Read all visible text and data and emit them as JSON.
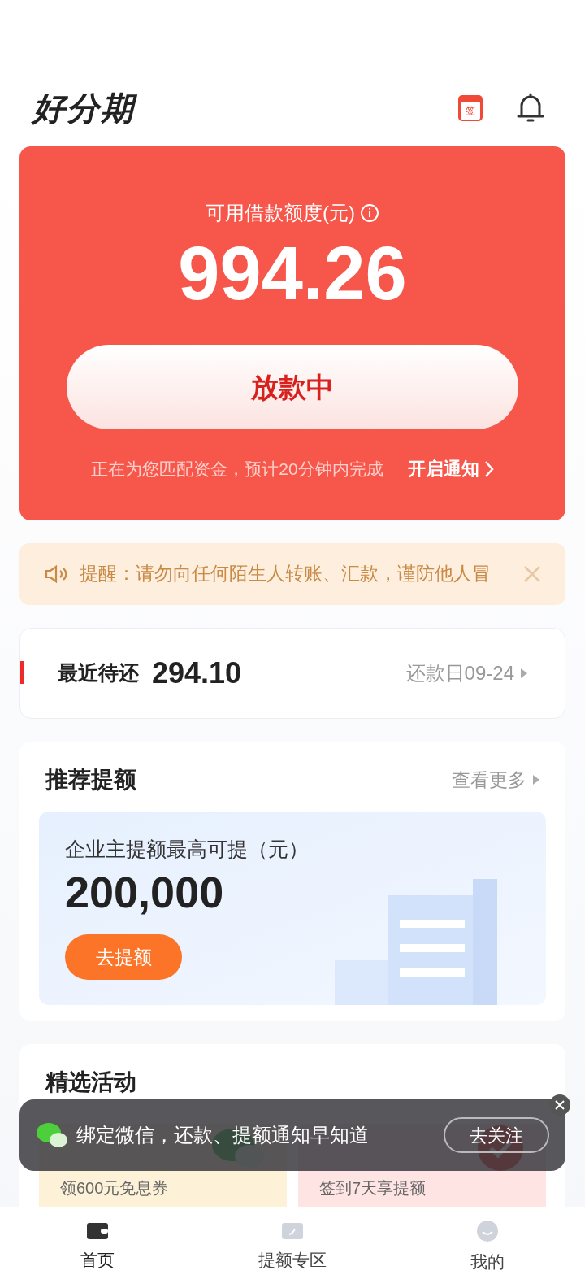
{
  "header": {
    "logo": "好分期",
    "checkin_badge": "签"
  },
  "credit_card": {
    "label": "可用借款额度(元)",
    "amount": "994.26",
    "button": "放款中",
    "status": "正在为您匹配资金，预计20分钟内完成",
    "notify_link": "开启通知"
  },
  "reminder": {
    "text": "提醒：请勿向任何陌生人转账、汇款，谨防他人冒"
  },
  "repayment": {
    "label": "最近待还",
    "amount": "294.10",
    "due": "还款日09-24"
  },
  "recommend": {
    "title": "推荐提额",
    "more": "查看更多",
    "offer_label": "企业主提额最高可提（元）",
    "offer_amount": "200,000",
    "button": "去提额"
  },
  "activities": {
    "title": "精选活动",
    "items": [
      {
        "subtitle": "领600元免息券",
        "kind": "wechat"
      },
      {
        "subtitle": "签到7天享提额",
        "kind": "checkin"
      }
    ]
  },
  "toast": {
    "text": "绑定微信，还款、提额通知早知道",
    "button": "去关注"
  },
  "nav": [
    {
      "label": "首页",
      "selected": true,
      "kind": "home"
    },
    {
      "label": "提额专区",
      "selected": false,
      "kind": "boost"
    },
    {
      "label": "我的",
      "selected": false,
      "kind": "me"
    }
  ]
}
